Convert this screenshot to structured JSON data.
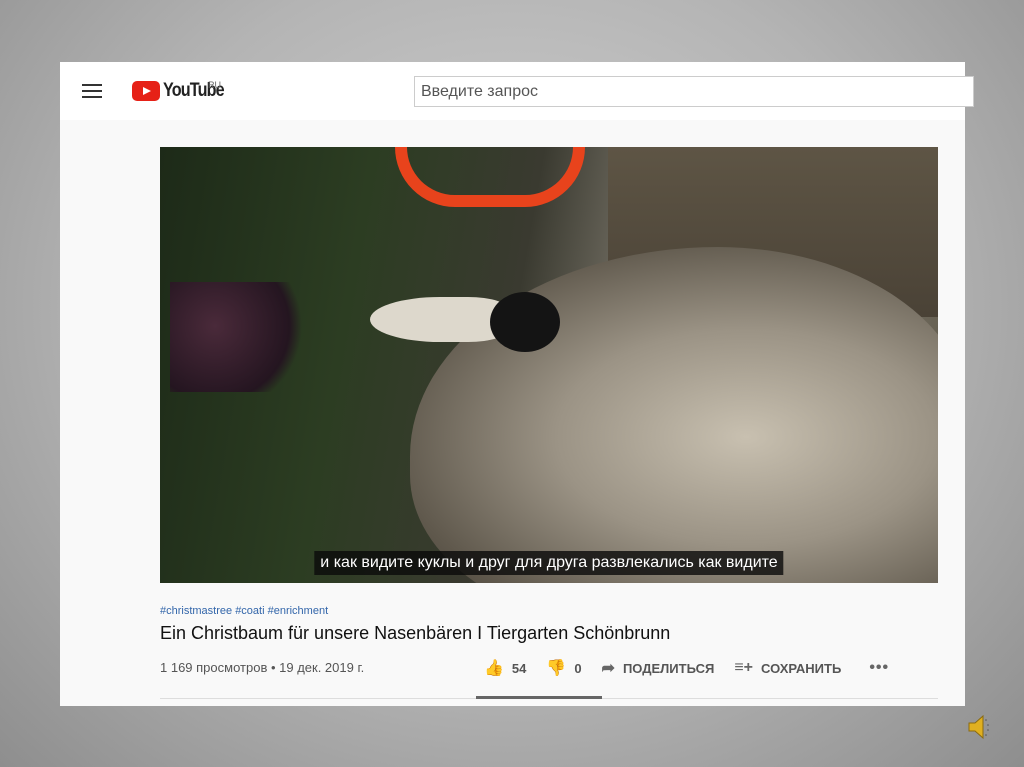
{
  "header": {
    "brand": "YouTube",
    "region": "RU",
    "search_placeholder": "Введите запрос"
  },
  "video": {
    "subtitle": "и как видите куклы и друг для друга развлекались как видите"
  },
  "info": {
    "hashtags": "#christmastree #coati #enrichment",
    "title": "Ein Christbaum für unsere Nasenbären I Tiergarten Schönbrunn",
    "meta": "1 169 просмотров • 19 дек. 2019 г.",
    "likes": "54",
    "dislikes": "0",
    "share": "ПОДЕЛИТЬСЯ",
    "save": "СОХРАНИТЬ"
  },
  "colors": {
    "brand_red": "#e62117",
    "hashtag": "#3366aa"
  }
}
